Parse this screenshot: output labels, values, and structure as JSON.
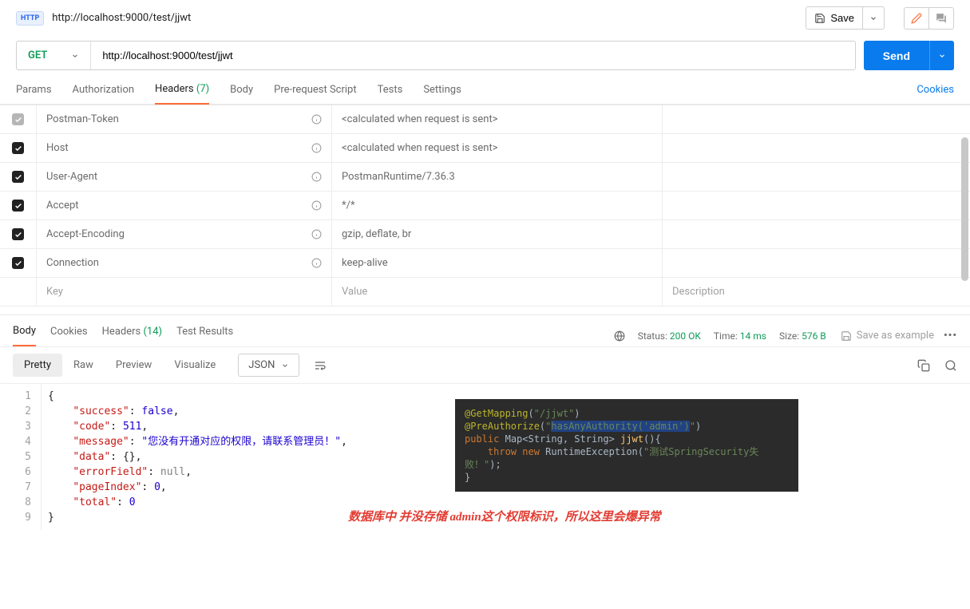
{
  "header": {
    "badge": "HTTP",
    "title": "http://localhost:9000/test/jjwt",
    "save_label": "Save"
  },
  "request": {
    "method": "GET",
    "url": "http://localhost:9000/test/jjwt",
    "send_label": "Send",
    "tabs": {
      "params": "Params",
      "authorization": "Authorization",
      "headers": "Headers",
      "headers_count": "(7)",
      "body": "Body",
      "prerequest": "Pre-request Script",
      "tests": "Tests",
      "settings": "Settings"
    },
    "cookies_link": "Cookies"
  },
  "headers_rows": [
    {
      "checked": "grey",
      "key": "Postman-Token",
      "value": "<calculated when request is sent>",
      "info": true
    },
    {
      "checked": "on",
      "key": "Host",
      "value": "<calculated when request is sent>",
      "info": true
    },
    {
      "checked": "on",
      "key": "User-Agent",
      "value": "PostmanRuntime/7.36.3",
      "info": true
    },
    {
      "checked": "on",
      "key": "Accept",
      "value": "*/*",
      "info": true
    },
    {
      "checked": "on",
      "key": "Accept-Encoding",
      "value": "gzip, deflate, br",
      "info": true
    },
    {
      "checked": "on",
      "key": "Connection",
      "value": "keep-alive",
      "info": true
    }
  ],
  "headers_placeholders": {
    "key": "Key",
    "value": "Value",
    "desc": "Description"
  },
  "response": {
    "tabs": {
      "body": "Body",
      "cookies": "Cookies",
      "headers": "Headers",
      "headers_count": "(14)",
      "tests": "Test Results"
    },
    "status_label": "Status:",
    "status_value": "200 OK",
    "time_label": "Time:",
    "time_value": "14 ms",
    "size_label": "Size:",
    "size_value": "576 B",
    "save_example": "Save as example"
  },
  "toolbar": {
    "pretty": "Pretty",
    "raw": "Raw",
    "preview": "Preview",
    "visualize": "Visualize",
    "format": "JSON"
  },
  "json_body": {
    "success": "false",
    "code": "511",
    "message": "\"您没有开通对应的权限，请联系管理员！\"",
    "data": "{}",
    "errorField": "null",
    "pageIndex": "0",
    "total": "0"
  },
  "overlay": {
    "line1_ann": "@GetMapping",
    "line1_str": "\"/jjwt\"",
    "line2_ann": "@PreAuthorize",
    "line2_str": "\"hasAnyAuthority('admin')\"",
    "line3a": "public",
    "line3b": "Map<String, String>",
    "line3c": "jjwt",
    "line4a": "throw new",
    "line4b": "RuntimeException",
    "line4c": "\"测试SpringSecurity失败！\""
  },
  "note": "数据库中 并没存储 admin这个权限标识，所以这里会爆异常"
}
